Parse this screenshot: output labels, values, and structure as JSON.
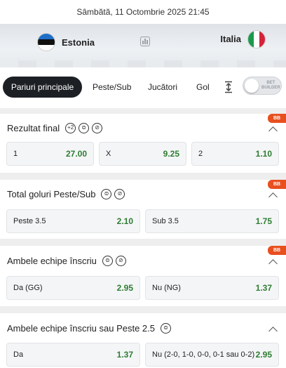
{
  "match": {
    "datetime": "Sâmbătă, 11 Octombrie 2025 21:45",
    "home_team": "Estonia",
    "away_team": "Italia"
  },
  "tabs": [
    {
      "label": "Pariuri principale",
      "active": true
    },
    {
      "label": "Peste/Sub"
    },
    {
      "label": "Jucători"
    },
    {
      "label": "Gol"
    }
  ],
  "bet_builder": {
    "label_line1": "BET",
    "label_line2": "BUILDER"
  },
  "badge": "BB",
  "markets": [
    {
      "title": "Rezultat final",
      "icons": [
        "+2",
        "⊜",
        "⊘"
      ],
      "has_bb": true,
      "outcomes": [
        {
          "label": "1",
          "odd": "27.00"
        },
        {
          "label": "X",
          "odd": "9.25"
        },
        {
          "label": "2",
          "odd": "1.10"
        }
      ]
    },
    {
      "title": "Total goluri Peste/Sub",
      "icons": [
        "⊜",
        "⊘"
      ],
      "has_bb": true,
      "outcomes": [
        {
          "label": "Peste 3.5",
          "odd": "2.10"
        },
        {
          "label": "Sub 3.5",
          "odd": "1.75"
        }
      ]
    },
    {
      "title": "Ambele echipe înscriu",
      "icons": [
        "⊜",
        "⊘"
      ],
      "has_bb": true,
      "outcomes": [
        {
          "label": "Da (GG)",
          "odd": "2.95"
        },
        {
          "label": "Nu (NG)",
          "odd": "1.37"
        }
      ]
    },
    {
      "title": "Ambele echipe înscriu sau Peste 2.5",
      "icons": [
        "⊜"
      ],
      "has_bb": false,
      "outcomes": [
        {
          "label": "Da",
          "odd": "1.37"
        },
        {
          "label": "Nu (2-0, 1-0, 0-0, 0-1 sau 0-2)",
          "odd": "2.95"
        }
      ]
    }
  ],
  "colors": {
    "odd_value": "#2e7d32",
    "badge": "#e8501f",
    "active_tab": "#1c1f24"
  }
}
